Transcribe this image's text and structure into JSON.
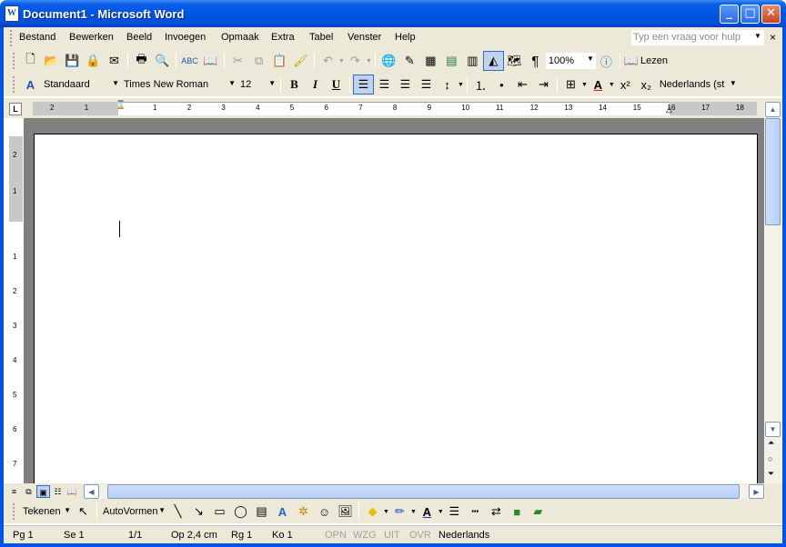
{
  "window": {
    "app_icon": "W",
    "title": "Document1 - Microsoft Word",
    "controls": {
      "minimize": "_",
      "maximize": "□",
      "close": "✕"
    }
  },
  "menu": {
    "items": [
      "Bestand",
      "Bewerken",
      "Beeld",
      "Invoegen",
      "Opmaak",
      "Extra",
      "Tabel",
      "Venster",
      "Help"
    ],
    "help_placeholder": "Typ een vraag voor hulp",
    "help_close": "×"
  },
  "standard_toolbar": {
    "icons": [
      "new-document-icon",
      "open-folder-icon",
      "save-icon",
      "permission-icon",
      "email-icon",
      "print-icon",
      "print-preview-icon",
      "spelling-icon",
      "research-icon",
      "cut-icon",
      "copy-icon",
      "paste-icon",
      "format-painter-icon",
      "undo-icon",
      "redo-icon",
      "hyperlink-icon",
      "tables-borders-icon",
      "insert-table-icon",
      "insert-excel-icon",
      "columns-icon",
      "drawing-icon",
      "document-map-icon",
      "show-formatting-icon",
      "help-icon"
    ],
    "zoom": "100%",
    "read_label": "Lezen"
  },
  "formatting_toolbar": {
    "style": "Standaard",
    "font": "Times New Roman",
    "size": "12",
    "bold": "B",
    "italic": "I",
    "underline": "U",
    "superscript": "x²",
    "subscript": "x₂",
    "language": "Nederlands (st"
  },
  "ruler": {
    "h_ticks": [
      "2",
      "1",
      "1",
      "2",
      "3",
      "4",
      "5",
      "6",
      "7",
      "8",
      "9",
      "10",
      "11",
      "12",
      "13",
      "14",
      "15",
      "16",
      "17",
      "18"
    ],
    "v_ticks": [
      "2",
      "1",
      "1",
      "2",
      "3",
      "4",
      "5",
      "6",
      "7"
    ]
  },
  "drawing_toolbar": {
    "draw_label": "Tekenen",
    "autoshapes_label": "AutoVormen"
  },
  "status": {
    "page": "Pg 1",
    "section": "Se 1",
    "page_of": "1/1",
    "at": "Op 2,4 cm",
    "line": "Rg 1",
    "col": "Ko 1",
    "rec": "OPN",
    "trk": "WZG",
    "ext": "UIT",
    "ovr": "OVR",
    "language": "Nederlands"
  },
  "colors": {
    "titlebar": "#0054e3",
    "frame": "#ece9d8",
    "workspace": "#808080"
  }
}
